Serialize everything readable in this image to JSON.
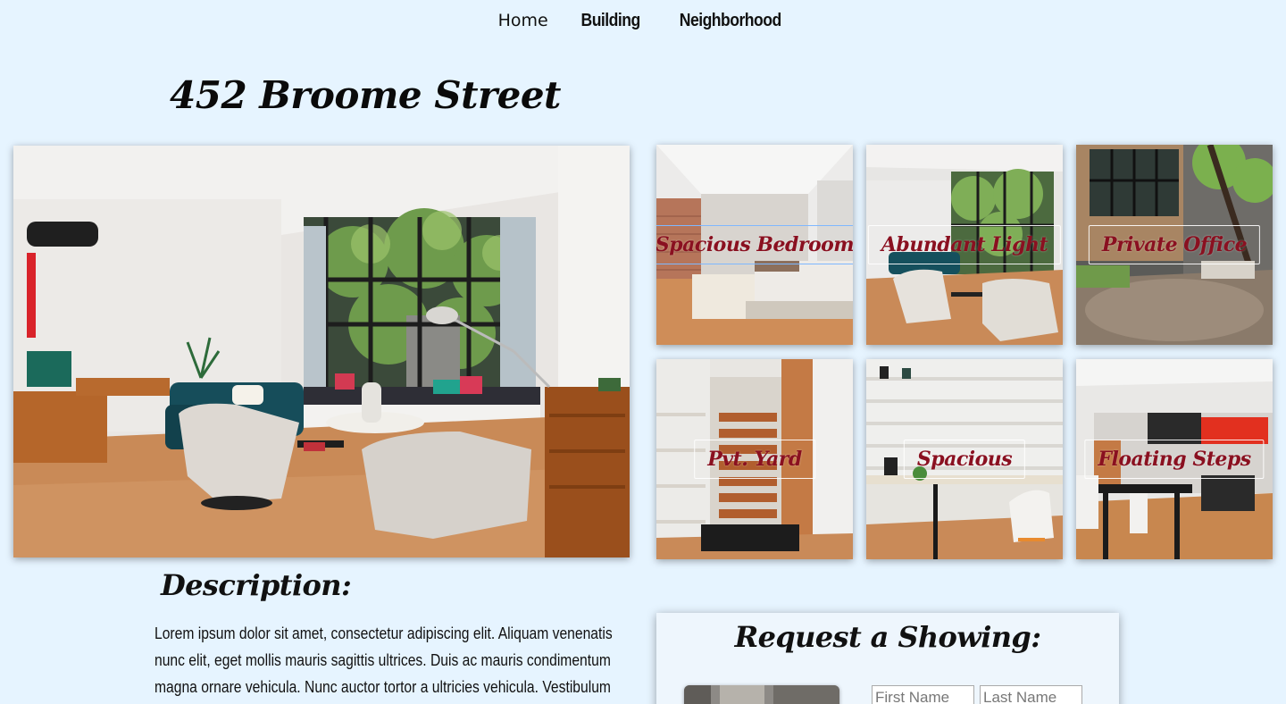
{
  "nav": {
    "items": [
      {
        "label": "Home"
      },
      {
        "label": "Building"
      },
      {
        "label": "Neighborhood"
      }
    ]
  },
  "page": {
    "title": "452 Broome Street"
  },
  "gallery": {
    "thumbs": [
      {
        "label": "Spacious Bedroom"
      },
      {
        "label": "Abundant Light"
      },
      {
        "label": "Private Office"
      },
      {
        "label": "Pvt. Yard"
      },
      {
        "label": "Spacious"
      },
      {
        "label": "Floating Steps"
      }
    ]
  },
  "description": {
    "heading": "Description:",
    "body": "Lorem ipsum dolor sit amet, consectetur adipiscing elit. Aliquam venenatis nunc elit, eget mollis mauris sagittis ultrices. Duis ac mauris condimentum magna ornare vehicula. Nunc auctor tortor a ultricies vehicula. Vestibulum fringilla massa"
  },
  "request": {
    "heading": "Request a Showing:",
    "first_name_placeholder": "First Name",
    "last_name_placeholder": "Last Name"
  },
  "colors": {
    "background": "#e6f4ff",
    "thumb_label": "#8a1020"
  }
}
